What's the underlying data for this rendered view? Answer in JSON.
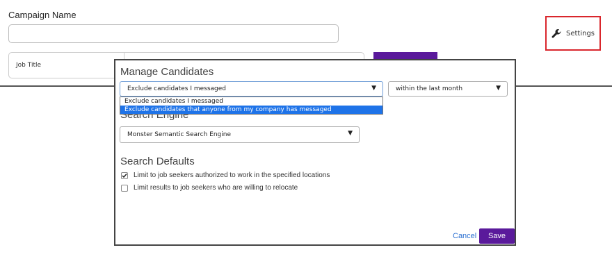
{
  "page": {
    "campaign_label": "Campaign Name",
    "settings_label": "Settings",
    "job_title_label": "Job Title"
  },
  "modal": {
    "title": "Manage Candidates",
    "exclude_select": {
      "value": "Exclude candidates I messaged",
      "options": [
        "Exclude candidates I messaged",
        "Exclude candidates that anyone from my company has messaged"
      ],
      "highlighted_index": 1
    },
    "within_select": {
      "value": "within the last month"
    },
    "search_engine_title": "Search Engine",
    "search_engine_select": {
      "value": "Monster Semantic Search Engine"
    },
    "search_defaults_title": "Search Defaults",
    "checkboxes": [
      {
        "label": "Limit to job seekers authorized to work in the specified locations",
        "checked": true
      },
      {
        "label": "Limit results to job seekers who are willing to relocate",
        "checked": false
      }
    ],
    "cancel_label": "Cancel",
    "save_label": "Save"
  },
  "colors": {
    "accent_purple": "#5a1a9b",
    "highlight_blue": "#1e73e8",
    "settings_border_red": "#d9262c",
    "link_blue": "#2a6fd1"
  },
  "icons": {
    "settings": "wrench-icon",
    "dropdown": "caret-down-icon",
    "check": "checkmark-icon"
  }
}
